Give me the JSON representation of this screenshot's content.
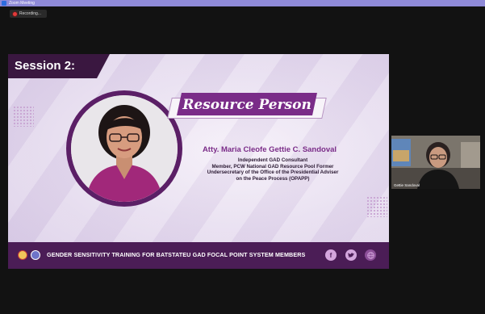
{
  "window": {
    "title": "Zoom Meeting"
  },
  "recording": {
    "label": "Recording..."
  },
  "slide": {
    "session_label": "Session 2:",
    "banner": "Resource Person",
    "name": "Atty. Maria Cleofe Gettie C. Sandoval",
    "lines": [
      "Independent GAD Consultant",
      "Member, PCW National GAD Resource Pool Former",
      "Undersecretary of the Office of the Presidential Adviser",
      "on the Peace Process (OPAPP)"
    ],
    "footer_text": "GENDER SENSITIVITY TRAINING FOR BATSTATEU GAD FOCAL POINT SYSTEM MEMBERS",
    "colors": {
      "primary": "#7a2c88",
      "footer": "#4b1d56",
      "session_tab": "#3a1740"
    },
    "social_icons": [
      "facebook-icon",
      "twitter-icon",
      "web-icon"
    ]
  },
  "participant": {
    "name": "Gettie Sandoval"
  }
}
